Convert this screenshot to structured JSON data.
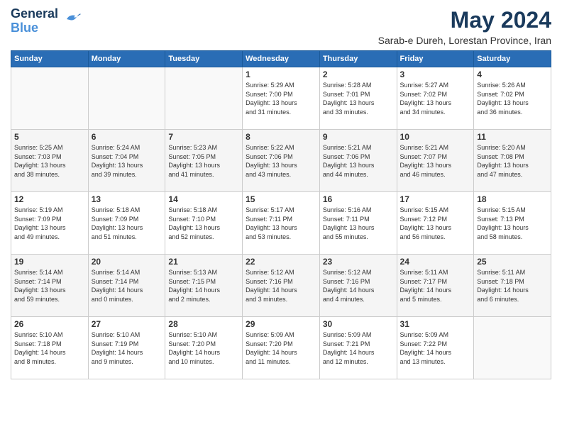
{
  "header": {
    "logo_line1": "General",
    "logo_line2": "Blue",
    "month": "May 2024",
    "location": "Sarab-e Dureh, Lorestan Province, Iran"
  },
  "days_of_week": [
    "Sunday",
    "Monday",
    "Tuesday",
    "Wednesday",
    "Thursday",
    "Friday",
    "Saturday"
  ],
  "weeks": [
    [
      {
        "day": "",
        "info": ""
      },
      {
        "day": "",
        "info": ""
      },
      {
        "day": "",
        "info": ""
      },
      {
        "day": "1",
        "info": "Sunrise: 5:29 AM\nSunset: 7:00 PM\nDaylight: 13 hours\nand 31 minutes."
      },
      {
        "day": "2",
        "info": "Sunrise: 5:28 AM\nSunset: 7:01 PM\nDaylight: 13 hours\nand 33 minutes."
      },
      {
        "day": "3",
        "info": "Sunrise: 5:27 AM\nSunset: 7:02 PM\nDaylight: 13 hours\nand 34 minutes."
      },
      {
        "day": "4",
        "info": "Sunrise: 5:26 AM\nSunset: 7:02 PM\nDaylight: 13 hours\nand 36 minutes."
      }
    ],
    [
      {
        "day": "5",
        "info": "Sunrise: 5:25 AM\nSunset: 7:03 PM\nDaylight: 13 hours\nand 38 minutes."
      },
      {
        "day": "6",
        "info": "Sunrise: 5:24 AM\nSunset: 7:04 PM\nDaylight: 13 hours\nand 39 minutes."
      },
      {
        "day": "7",
        "info": "Sunrise: 5:23 AM\nSunset: 7:05 PM\nDaylight: 13 hours\nand 41 minutes."
      },
      {
        "day": "8",
        "info": "Sunrise: 5:22 AM\nSunset: 7:06 PM\nDaylight: 13 hours\nand 43 minutes."
      },
      {
        "day": "9",
        "info": "Sunrise: 5:21 AM\nSunset: 7:06 PM\nDaylight: 13 hours\nand 44 minutes."
      },
      {
        "day": "10",
        "info": "Sunrise: 5:21 AM\nSunset: 7:07 PM\nDaylight: 13 hours\nand 46 minutes."
      },
      {
        "day": "11",
        "info": "Sunrise: 5:20 AM\nSunset: 7:08 PM\nDaylight: 13 hours\nand 47 minutes."
      }
    ],
    [
      {
        "day": "12",
        "info": "Sunrise: 5:19 AM\nSunset: 7:09 PM\nDaylight: 13 hours\nand 49 minutes."
      },
      {
        "day": "13",
        "info": "Sunrise: 5:18 AM\nSunset: 7:09 PM\nDaylight: 13 hours\nand 51 minutes."
      },
      {
        "day": "14",
        "info": "Sunrise: 5:18 AM\nSunset: 7:10 PM\nDaylight: 13 hours\nand 52 minutes."
      },
      {
        "day": "15",
        "info": "Sunrise: 5:17 AM\nSunset: 7:11 PM\nDaylight: 13 hours\nand 53 minutes."
      },
      {
        "day": "16",
        "info": "Sunrise: 5:16 AM\nSunset: 7:11 PM\nDaylight: 13 hours\nand 55 minutes."
      },
      {
        "day": "17",
        "info": "Sunrise: 5:15 AM\nSunset: 7:12 PM\nDaylight: 13 hours\nand 56 minutes."
      },
      {
        "day": "18",
        "info": "Sunrise: 5:15 AM\nSunset: 7:13 PM\nDaylight: 13 hours\nand 58 minutes."
      }
    ],
    [
      {
        "day": "19",
        "info": "Sunrise: 5:14 AM\nSunset: 7:14 PM\nDaylight: 13 hours\nand 59 minutes."
      },
      {
        "day": "20",
        "info": "Sunrise: 5:14 AM\nSunset: 7:14 PM\nDaylight: 14 hours\nand 0 minutes."
      },
      {
        "day": "21",
        "info": "Sunrise: 5:13 AM\nSunset: 7:15 PM\nDaylight: 14 hours\nand 2 minutes."
      },
      {
        "day": "22",
        "info": "Sunrise: 5:12 AM\nSunset: 7:16 PM\nDaylight: 14 hours\nand 3 minutes."
      },
      {
        "day": "23",
        "info": "Sunrise: 5:12 AM\nSunset: 7:16 PM\nDaylight: 14 hours\nand 4 minutes."
      },
      {
        "day": "24",
        "info": "Sunrise: 5:11 AM\nSunset: 7:17 PM\nDaylight: 14 hours\nand 5 minutes."
      },
      {
        "day": "25",
        "info": "Sunrise: 5:11 AM\nSunset: 7:18 PM\nDaylight: 14 hours\nand 6 minutes."
      }
    ],
    [
      {
        "day": "26",
        "info": "Sunrise: 5:10 AM\nSunset: 7:18 PM\nDaylight: 14 hours\nand 8 minutes."
      },
      {
        "day": "27",
        "info": "Sunrise: 5:10 AM\nSunset: 7:19 PM\nDaylight: 14 hours\nand 9 minutes."
      },
      {
        "day": "28",
        "info": "Sunrise: 5:10 AM\nSunset: 7:20 PM\nDaylight: 14 hours\nand 10 minutes."
      },
      {
        "day": "29",
        "info": "Sunrise: 5:09 AM\nSunset: 7:20 PM\nDaylight: 14 hours\nand 11 minutes."
      },
      {
        "day": "30",
        "info": "Sunrise: 5:09 AM\nSunset: 7:21 PM\nDaylight: 14 hours\nand 12 minutes."
      },
      {
        "day": "31",
        "info": "Sunrise: 5:09 AM\nSunset: 7:22 PM\nDaylight: 14 hours\nand 13 minutes."
      },
      {
        "day": "",
        "info": ""
      }
    ]
  ]
}
